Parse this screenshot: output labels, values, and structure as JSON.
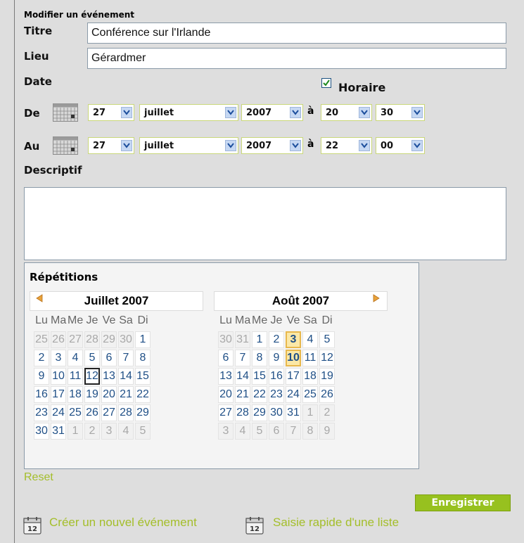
{
  "form": {
    "heading": "Modifier un événement",
    "title_label": "Titre",
    "title_value": "Conférence sur l'Irlande",
    "place_label": "Lieu",
    "place_value": "Gérardmer",
    "date_label": "Date",
    "horaire_label": "Horaire",
    "horaire_checked": true,
    "from_label": "De",
    "to_label": "Au",
    "a_label": "à",
    "from": {
      "day": "27",
      "month": "juillet",
      "year": "2007",
      "hour": "20",
      "minute": "30"
    },
    "to": {
      "day": "27",
      "month": "juillet",
      "year": "2007",
      "hour": "22",
      "minute": "00"
    },
    "description_label": "Descriptif",
    "description_value": ""
  },
  "repetitions": {
    "title": "Répétitions",
    "weekdays": [
      "Lu",
      "Ma",
      "Me",
      "Je",
      "Ve",
      "Sa",
      "Di"
    ],
    "left": {
      "title": "Juillet 2007",
      "days": [
        [
          "25",
          "26",
          "27",
          "28",
          "29",
          "30",
          "1"
        ],
        [
          "2",
          "3",
          "4",
          "5",
          "6",
          "7",
          "8"
        ],
        [
          "9",
          "10",
          "11",
          "12",
          "13",
          "14",
          "15"
        ],
        [
          "16",
          "17",
          "18",
          "19",
          "20",
          "21",
          "22"
        ],
        [
          "23",
          "24",
          "25",
          "26",
          "27",
          "28",
          "29"
        ],
        [
          "30",
          "31",
          "1",
          "2",
          "3",
          "4",
          "5"
        ]
      ]
    },
    "right": {
      "title": "Août 2007",
      "days": [
        [
          "30",
          "31",
          "1",
          "2",
          "3",
          "4",
          "5"
        ],
        [
          "6",
          "7",
          "8",
          "9",
          "10",
          "11",
          "12"
        ],
        [
          "13",
          "14",
          "15",
          "16",
          "17",
          "18",
          "19"
        ],
        [
          "20",
          "21",
          "22",
          "23",
          "24",
          "25",
          "26"
        ],
        [
          "27",
          "28",
          "29",
          "30",
          "31",
          "1",
          "2"
        ],
        [
          "3",
          "4",
          "5",
          "6",
          "7",
          "8",
          "9"
        ]
      ]
    },
    "reset_label": "Reset"
  },
  "actions": {
    "save_label": "Enregistrer",
    "new_event_label": "Créer un nouvel événement",
    "quick_list_label": "Saisie rapide d'une liste"
  },
  "icons": {
    "calendar_icon_day": "12"
  },
  "colors": {
    "accent_green": "#97c11f",
    "link_green": "#a4be2a",
    "select_border": "#c9d77a",
    "selected_day": "#fbe8a7"
  }
}
